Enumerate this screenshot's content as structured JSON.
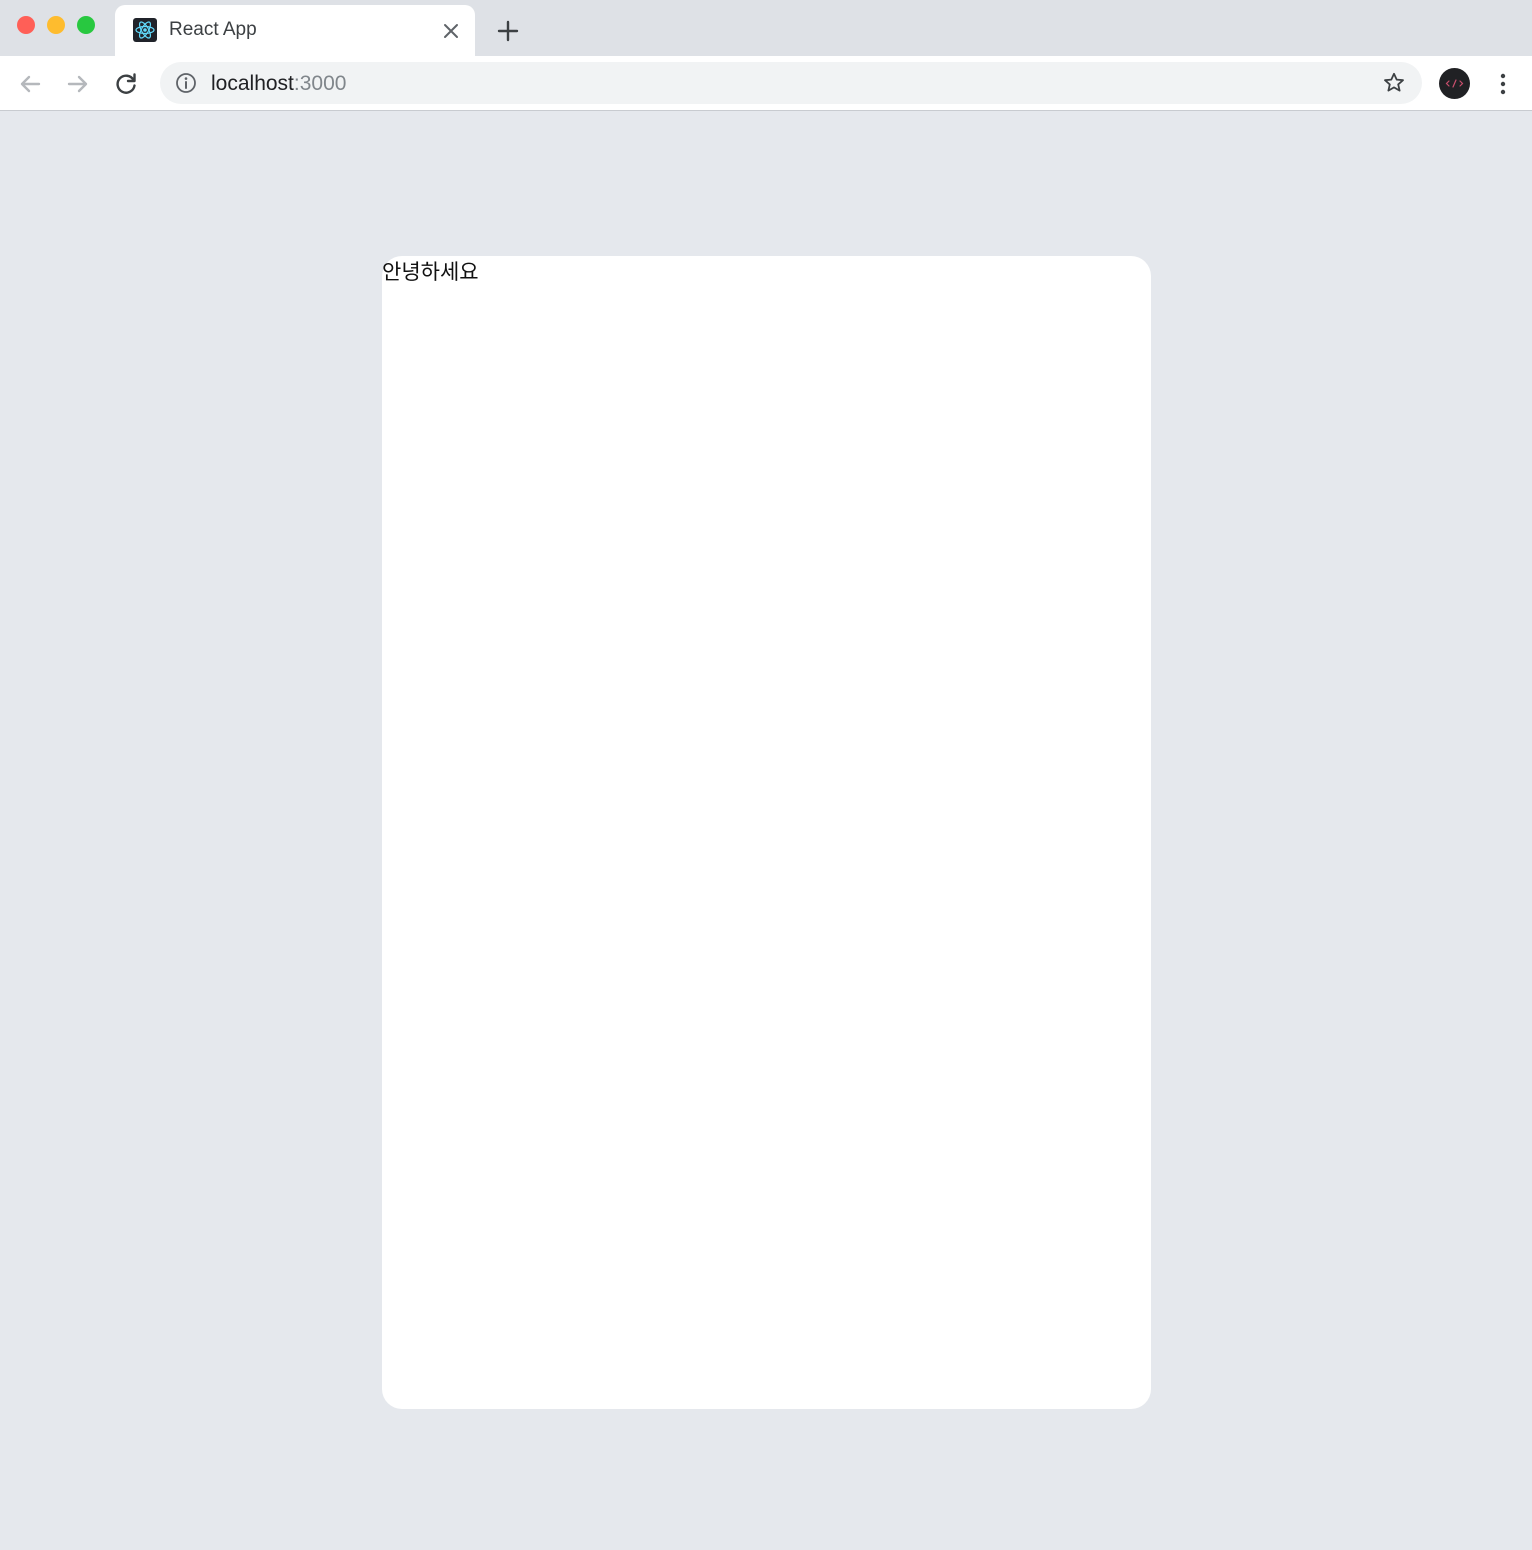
{
  "window": {
    "traffic_lights": {
      "close": "#ff5f57",
      "minimize": "#febc2e",
      "zoom": "#28c840"
    }
  },
  "tabs": [
    {
      "title": "React App",
      "favicon": "react-logo-icon",
      "active": true
    }
  ],
  "toolbar": {
    "url_host": "localhost",
    "url_port": ":3000",
    "icons": [
      "back-arrow-icon",
      "forward-arrow-icon",
      "reload-icon",
      "info-icon",
      "star-icon",
      "kebab-menu-icon"
    ]
  },
  "page": {
    "card_text": "안녕하세요",
    "background": "#e5e8ed",
    "card_background": "#ffffff"
  }
}
